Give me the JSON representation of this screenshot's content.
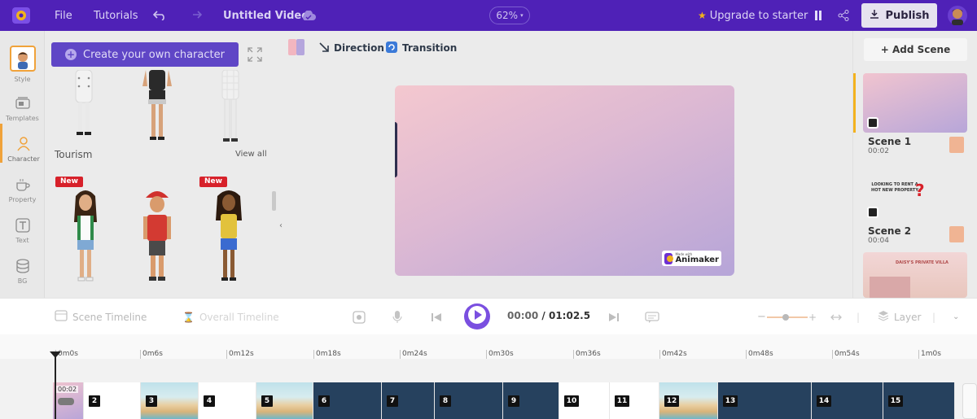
{
  "topbar": {
    "file": "File",
    "tutorials": "Tutorials",
    "title": "Untitled Video",
    "zoom": "62%",
    "upgrade": "Upgrade to starter",
    "publish": "Publish"
  },
  "rail": [
    {
      "label": "Style",
      "icon": "avatar-icon"
    },
    {
      "label": "Templates",
      "icon": "templates-icon"
    },
    {
      "label": "Character",
      "icon": "character-icon"
    },
    {
      "label": "Property",
      "icon": "property-icon"
    },
    {
      "label": "Text",
      "icon": "text-icon"
    },
    {
      "label": "BG",
      "icon": "bg-icon"
    }
  ],
  "panel": {
    "create_button": "Create your own character",
    "section_title": "Tourism",
    "view_all": "View all",
    "new_tag": "New"
  },
  "canvas_toolbar": {
    "direction": "Direction",
    "transition": "Transition"
  },
  "watermark": {
    "small": "Made with",
    "brand": "Animaker"
  },
  "scenes": {
    "add_scene": "+ Add Scene",
    "items": [
      {
        "name": "Scene 1",
        "duration": "00:02"
      },
      {
        "name": "Scene 2",
        "duration": "00:04",
        "thumb_text": "LOOKING TO RENT A HOT NEW PROPERTY"
      },
      {
        "thumb_text": "DAISY'S PRIVATE VILLA"
      }
    ]
  },
  "controls": {
    "scene_timeline": "Scene Timeline",
    "overall_timeline": "Overall Timeline",
    "current_time": "00:00",
    "separator": "/",
    "total_time": "01:02.5",
    "layer": "Layer"
  },
  "ruler": [
    "0m0s",
    "0m6s",
    "0m12s",
    "0m18s",
    "0m24s",
    "0m30s",
    "0m36s",
    "0m42s",
    "0m48s",
    "0m54s",
    "1m0s"
  ],
  "track": {
    "first_clip_time": "00:02",
    "clips": [
      "2",
      "3",
      "4",
      "5",
      "6",
      "7",
      "8",
      "9",
      "10",
      "11",
      "12",
      "13",
      "14",
      "15"
    ]
  },
  "colors": {
    "topbar": "#4f21b7",
    "accent": "#7a4fe0",
    "dark_clip": "#26415e",
    "new_tag": "#d7212a",
    "selected_scene": "#f3b21e"
  }
}
